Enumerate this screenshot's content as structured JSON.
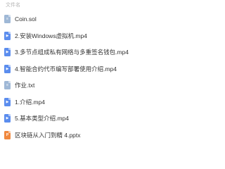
{
  "header": {
    "column_label": "文件名"
  },
  "files": [
    {
      "name": "Coin.sol",
      "icon": "document-icon",
      "type": "doc"
    },
    {
      "name": "2.安装Windows虚拟机.mp4",
      "icon": "video-file-icon",
      "type": "video"
    },
    {
      "name": "3.多节点组成私有网络与多重签名钱包.mp4",
      "icon": "video-file-icon",
      "type": "video"
    },
    {
      "name": "4.智能合约代币编写部署使用介绍.mp4",
      "icon": "video-file-icon",
      "type": "video"
    },
    {
      "name": "作业.txt",
      "icon": "text-file-icon",
      "type": "doc"
    },
    {
      "name": "1.介绍.mp4",
      "icon": "video-file-icon",
      "type": "video"
    },
    {
      "name": "5.基本类型介绍.mp4",
      "icon": "video-file-icon",
      "type": "video"
    },
    {
      "name": "区块链从入门到精 4.pptx",
      "icon": "ppt-file-icon",
      "type": "ppt"
    }
  ],
  "colors": {
    "doc_icon": "#9fb8d6",
    "video_icon": "#5b8dee",
    "ppt_icon": "#f0883e",
    "text": "#333333",
    "header_text": "#b3b3b3"
  }
}
